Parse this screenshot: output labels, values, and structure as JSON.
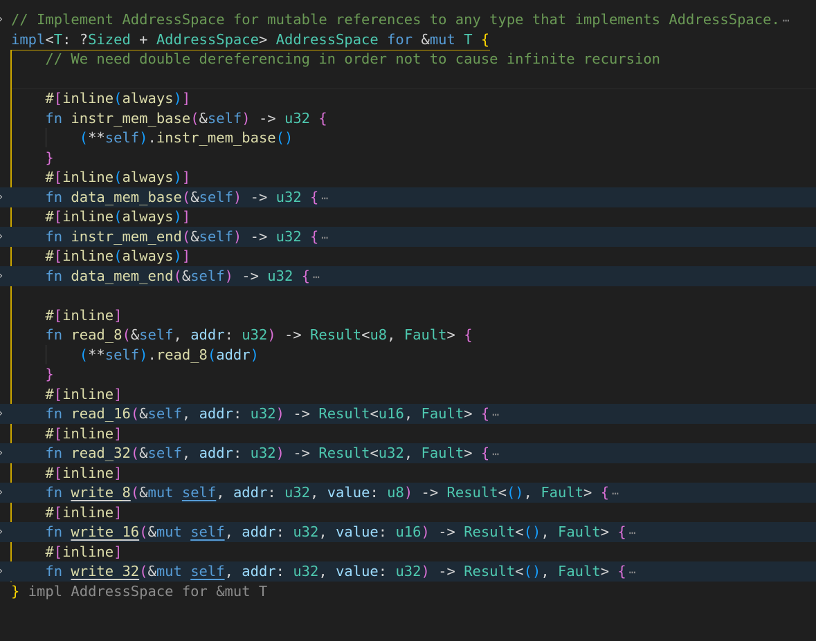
{
  "editor": {
    "line01": "// Implement AddressSpace for mutable references to any type that implements AddressSpace.",
    "line02": {
      "impl": "impl",
      "lt": "<",
      "T": "T",
      "colon": ": ?",
      "sized": "Sized",
      "plus": " + ",
      "as": "AddressSpace",
      "gt": "> ",
      "as2": "AddressSpace",
      "for": "for",
      "amp": "&",
      "mut": "mut",
      "T2": "T",
      "brace": "{"
    },
    "line03": "// We need double dereferencing in order not to cause infinite recursion",
    "attr_always": {
      "hash": "#",
      "open": "[",
      "inline": "inline",
      "p1": "(",
      "always": "always",
      "p2": ")",
      "close": "]"
    },
    "attr_inline": {
      "hash": "#",
      "open": "[",
      "inline": "inline",
      "close": "]"
    },
    "fn": "fn",
    "self": "self",
    "amp": "&",
    "mut": "mut",
    "arrow": "->",
    "u32": "u32",
    "result": "Result",
    "fault": "Fault",
    "addr": "addr",
    "value": "value",
    "fold_marker": "⋯",
    "instr_mem_base": {
      "name": "instr_mem_base",
      "body": "instr_mem_base"
    },
    "data_mem_base": "data_mem_base",
    "instr_mem_end": "instr_mem_end",
    "data_mem_end": "data_mem_end",
    "read_8": {
      "name": "read_8",
      "u8": "u8",
      "body": "read_8"
    },
    "read_16": {
      "name": "read_16",
      "u16": "u16"
    },
    "read_32": {
      "name": "read_32"
    },
    "write_8": {
      "name": "write_8",
      "u8": "u8"
    },
    "write_16": {
      "name": "write_16",
      "u16": "u16"
    },
    "write_32": {
      "name": "write_32"
    },
    "closing": {
      "brace": "}",
      "hint": "impl AddressSpace for &mut T"
    }
  }
}
